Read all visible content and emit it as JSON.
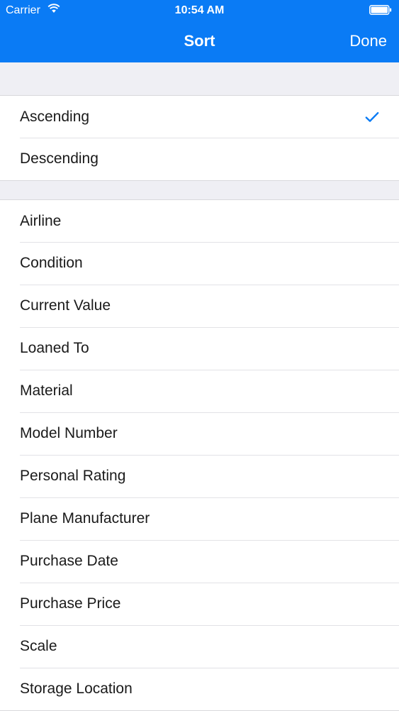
{
  "status_bar": {
    "carrier": "Carrier",
    "time": "10:54 AM"
  },
  "nav_bar": {
    "title": "Sort",
    "done_label": "Done"
  },
  "order_section": {
    "items": [
      {
        "label": "Ascending",
        "selected": true
      },
      {
        "label": "Descending",
        "selected": false
      }
    ]
  },
  "fields_section": {
    "items": [
      {
        "label": "Airline"
      },
      {
        "label": "Condition"
      },
      {
        "label": "Current Value"
      },
      {
        "label": "Loaned To"
      },
      {
        "label": "Material"
      },
      {
        "label": "Model Number"
      },
      {
        "label": "Personal Rating"
      },
      {
        "label": "Plane Manufacturer"
      },
      {
        "label": "Purchase Date"
      },
      {
        "label": "Purchase Price"
      },
      {
        "label": "Scale"
      },
      {
        "label": "Storage Location"
      }
    ]
  },
  "colors": {
    "accent": "#0a7bf5",
    "background": "#efeff4"
  },
  "icons": [
    "wifi-icon",
    "battery-icon",
    "checkmark-icon"
  ]
}
